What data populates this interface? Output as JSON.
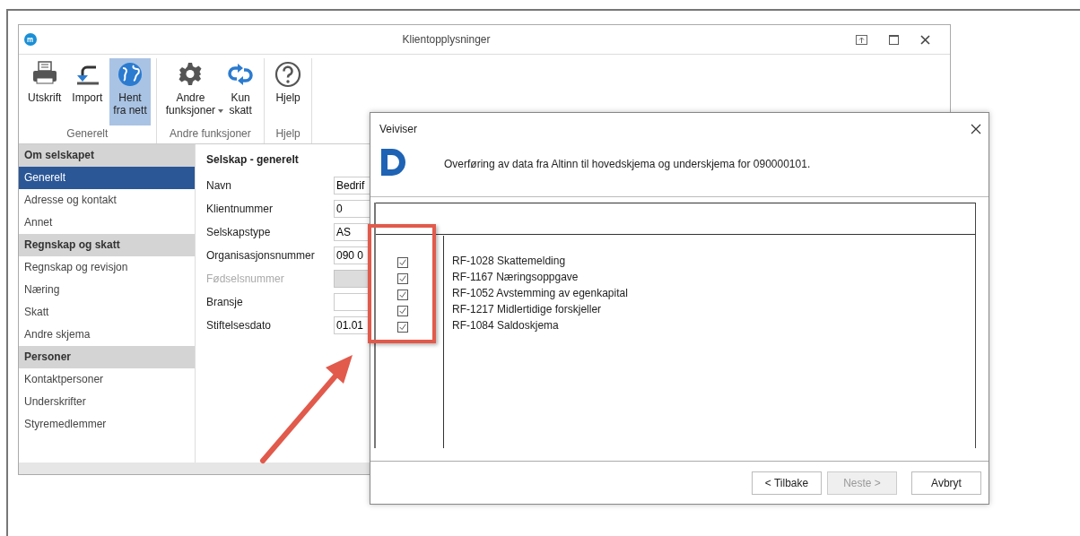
{
  "window": {
    "title": "Klientopplysninger"
  },
  "ribbon": {
    "groups": [
      {
        "label": "Generelt",
        "buttons": [
          {
            "label": "Utskrift",
            "kind": "printer",
            "selected": false,
            "dropdown": false
          },
          {
            "label": "Import",
            "kind": "import",
            "selected": false,
            "dropdown": false
          },
          {
            "label": "Hent\nfra nett",
            "kind": "globe",
            "selected": true,
            "dropdown": false
          }
        ]
      },
      {
        "label": "Andre funksjoner",
        "buttons": [
          {
            "label": "Andre\nfunksjoner",
            "kind": "gear",
            "selected": false,
            "dropdown": true
          },
          {
            "label": "Kun\nskatt",
            "kind": "cycle",
            "selected": false,
            "dropdown": false
          }
        ]
      },
      {
        "label": "Hjelp",
        "buttons": [
          {
            "label": "Hjelp",
            "kind": "help",
            "selected": false,
            "dropdown": false
          }
        ]
      }
    ]
  },
  "sidebar": {
    "sections": [
      {
        "header": "Om selskapet",
        "items": [
          {
            "label": "Generelt",
            "selected": true
          },
          {
            "label": "Adresse og kontakt",
            "selected": false
          },
          {
            "label": "Annet",
            "selected": false
          }
        ]
      },
      {
        "header": "Regnskap og skatt",
        "items": [
          {
            "label": "Regnskap og revisjon",
            "selected": false
          },
          {
            "label": "Næring",
            "selected": false
          },
          {
            "label": "Skatt",
            "selected": false
          },
          {
            "label": "Andre skjema",
            "selected": false
          }
        ]
      },
      {
        "header": "Personer",
        "items": [
          {
            "label": "Kontaktpersoner",
            "selected": false
          },
          {
            "label": "Underskrifter",
            "selected": false
          },
          {
            "label": "Styremedlemmer",
            "selected": false
          }
        ]
      }
    ]
  },
  "form": {
    "title": "Selskap - generelt",
    "fields": [
      {
        "label": "Navn",
        "value": "Bedrif",
        "disabled": false
      },
      {
        "label": "Klientnummer",
        "value": "0",
        "disabled": false
      },
      {
        "label": "Selskapstype",
        "value": "AS",
        "disabled": false
      },
      {
        "label": "Organisasjonsnummer",
        "value": "090 0",
        "disabled": false
      },
      {
        "label": "Fødselsnummer",
        "disabled": true
      },
      {
        "label": "Bransje",
        "disabled": false
      },
      {
        "label": "Stiftelsesdato",
        "value": "01.01",
        "disabled": false
      }
    ]
  },
  "dialog": {
    "title": "Veiviser",
    "message": "Overføring av data fra Altinn til hovedskjema og underskjema for 090000101.",
    "rows": [
      {
        "label": "RF-1028 Skattemelding",
        "checked": true
      },
      {
        "label": "RF-1167 Næringsoppgave",
        "checked": true
      },
      {
        "label": "RF-1052 Avstemming av egenkapital",
        "checked": true
      },
      {
        "label": "RF-1217 Midlertidige forskjeller",
        "checked": true
      },
      {
        "label": "RF-1084 Saldoskjema",
        "checked": true
      }
    ],
    "buttons": [
      {
        "label": "< Tilbake",
        "disabled": false
      },
      {
        "label": "Neste >",
        "disabled": true
      },
      {
        "label": "Avbryt",
        "disabled": false
      }
    ]
  }
}
